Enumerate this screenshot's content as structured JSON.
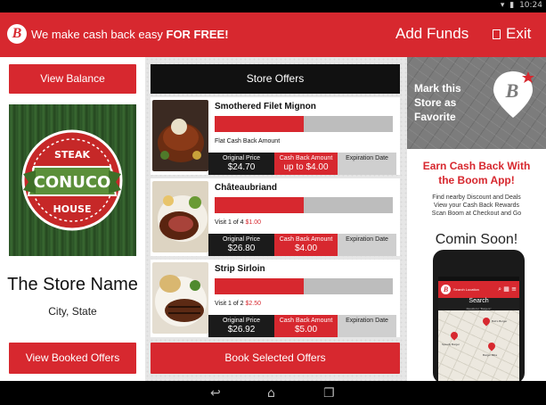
{
  "status_bar": {
    "wifi": "wifi-icon",
    "battery": "battery-icon",
    "time": "10:24"
  },
  "header": {
    "tagline_regular": "We make cash back easy ",
    "tagline_bold": "FOR FREE!",
    "add_funds": "Add Funds",
    "exit": "Exit"
  },
  "left": {
    "view_balance": "View Balance",
    "logo_text": {
      "top": "STEAK",
      "middle": "CONUCO",
      "bottom": "HOUSE"
    },
    "store_name": "The Store Name",
    "store_location": "City, State",
    "view_booked_offers": "View Booked Offers"
  },
  "middle": {
    "header": "Store Offers",
    "column_labels": {
      "price": "Original Price",
      "cashback": "Cash Back Amount",
      "expiry": "Expiration Date"
    },
    "offers": [
      {
        "name": "Smothered Filet Mignon",
        "progress": 0.5,
        "sub_text": "Flat Cash Back Amount",
        "sub_red": "",
        "price": "$24.70",
        "cashback": "up to $4.00",
        "expiry": ""
      },
      {
        "name": "Châteaubriand",
        "progress": 0.5,
        "sub_text": "Visit 1 of 4 ",
        "sub_red": "$1.00",
        "price": "$26.80",
        "cashback": "$4.00",
        "expiry": ""
      },
      {
        "name": "Strip Sirloin",
        "progress": 0.5,
        "sub_text": "Visit 1 of 2 ",
        "sub_red": "$2.50",
        "price": "$26.92",
        "cashback": "$5.00",
        "expiry": ""
      }
    ],
    "book_selected": "Book Selected Offers"
  },
  "right": {
    "favorite_lines": [
      "Mark this",
      "Store as",
      "Favorite"
    ],
    "earn_title_lines": [
      "Earn Cash Back With",
      "the Boom App!"
    ],
    "earn_desc_lines": [
      "Find nearby Discount and Deals",
      "View your Cash Back Rewards",
      "Scan Boom at Checkout and Go"
    ],
    "coming_soon": "Comin Soon!",
    "phone": {
      "search_placeholder": "Search Location",
      "search_title": "Search",
      "search_sub": "Results for \"Burgers\"",
      "places": [
        "Bob's Burger",
        "Speedy Burger",
        "Burger Bliss"
      ]
    }
  },
  "colors": {
    "brand_red": "#d7282f",
    "dark": "#111111",
    "gray_bar": "#bdbdbd"
  }
}
